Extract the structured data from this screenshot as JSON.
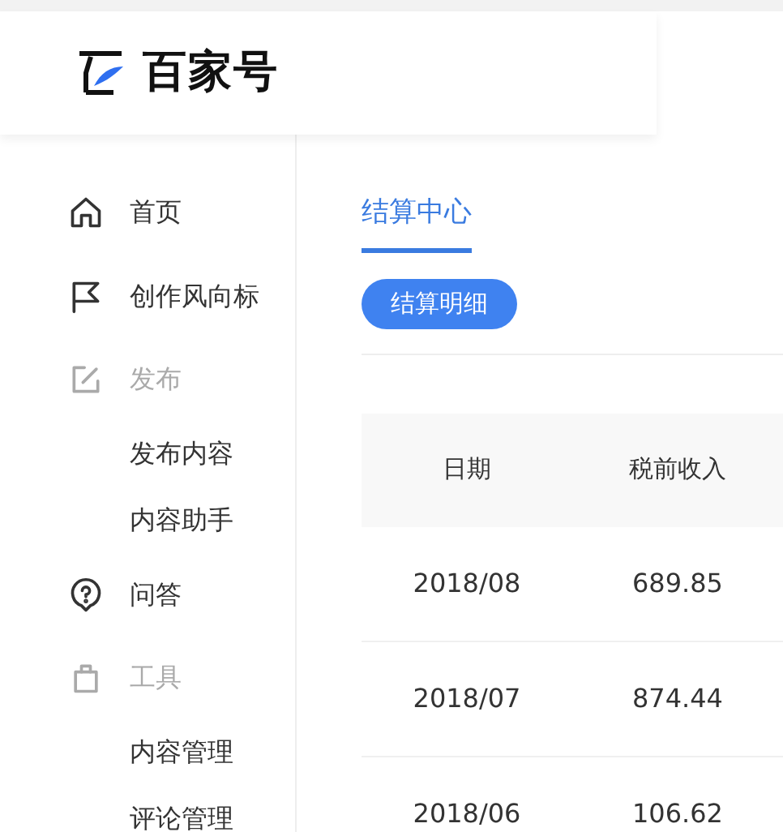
{
  "header": {
    "logo_text": "百家号"
  },
  "sidebar": {
    "items": [
      {
        "label": "首页",
        "kind": "link"
      },
      {
        "label": "创作风向标",
        "kind": "link"
      },
      {
        "label": "发布",
        "kind": "group"
      },
      {
        "label": "发布内容",
        "kind": "subitem"
      },
      {
        "label": "内容助手",
        "kind": "subitem"
      },
      {
        "label": "问答",
        "kind": "link"
      },
      {
        "label": "工具",
        "kind": "group"
      },
      {
        "label": "内容管理",
        "kind": "subitem"
      },
      {
        "label": "评论管理",
        "kind": "subitem"
      }
    ]
  },
  "tabs": [
    {
      "label": "结算中心",
      "selected": true
    }
  ],
  "filters": [
    {
      "label": "结算明细",
      "selected": true
    }
  ],
  "table": {
    "columns": [
      "日期",
      "税前收入"
    ],
    "rows": [
      [
        "2018/08",
        "689.85"
      ],
      [
        "2018/07",
        "874.44"
      ],
      [
        "2018/06",
        "106.62"
      ]
    ]
  }
}
